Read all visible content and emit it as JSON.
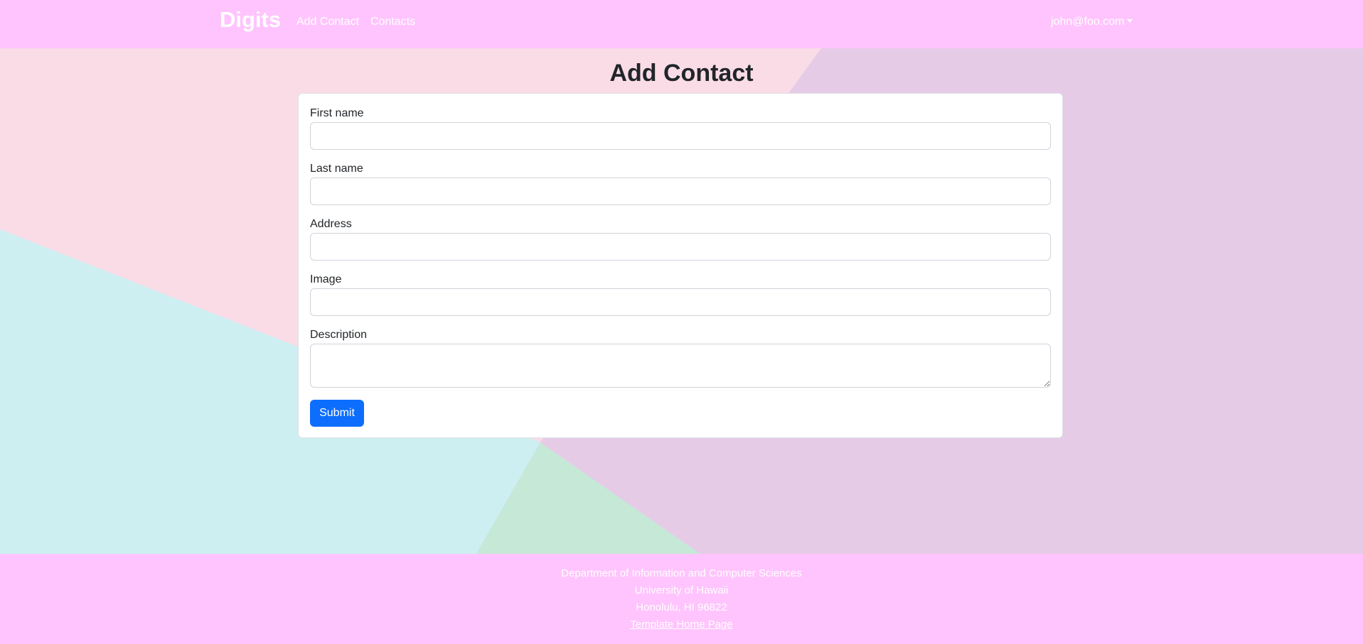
{
  "navbar": {
    "brand": "Digits",
    "links": [
      {
        "label": "Add Contact"
      },
      {
        "label": "Contacts"
      }
    ],
    "user": "john@foo.com"
  },
  "page": {
    "title": "Add Contact"
  },
  "form": {
    "fields": [
      {
        "label": "First name",
        "value": ""
      },
      {
        "label": "Last name",
        "value": ""
      },
      {
        "label": "Address",
        "value": ""
      },
      {
        "label": "Image",
        "value": ""
      },
      {
        "label": "Description",
        "value": ""
      }
    ],
    "submit_label": "Submit"
  },
  "footer": {
    "line1": "Department of Information and Computer Sciences",
    "line2": "University of Hawaii",
    "line3": "Honolulu, HI 96822",
    "link": "Template Home Page"
  },
  "colors": {
    "navbar_bg": "#ffc4fd",
    "primary_button": "#0d6efd"
  }
}
